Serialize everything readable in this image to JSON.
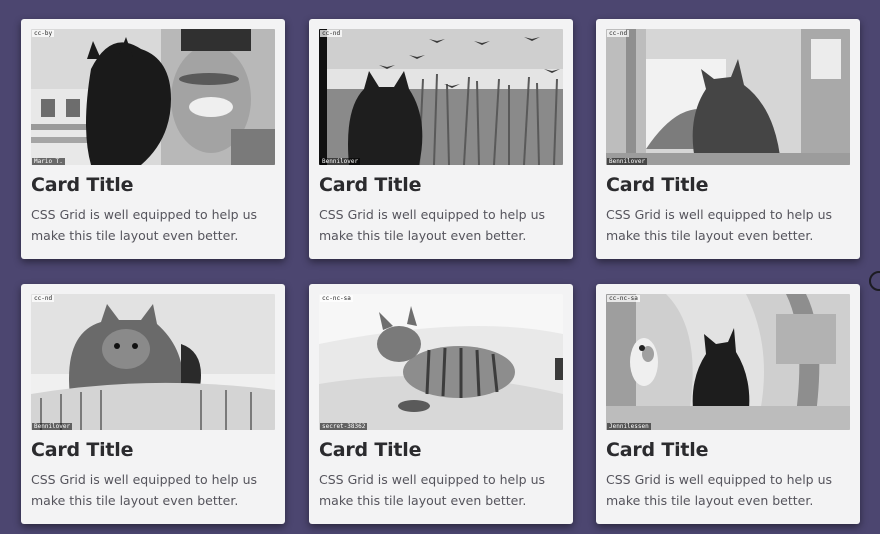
{
  "cards": [
    {
      "title": "Card Title",
      "description": "CSS Grid is well equipped to help us make this tile layout even better.",
      "image": {
        "alt": "man holding black cat",
        "license": "cc-by",
        "credit": "Mario T."
      }
    },
    {
      "title": "Card Title",
      "description": "CSS Grid is well equipped to help us make this tile layout even better.",
      "image": {
        "alt": "cat watching birds over wheat field",
        "license": "cc-nd",
        "credit": "Bennilover"
      }
    },
    {
      "title": "Card Title",
      "description": "CSS Grid is well equipped to help us make this tile layout even better.",
      "image": {
        "alt": "tabby cat at window",
        "license": "cc-nd",
        "credit": "Bennilover"
      }
    },
    {
      "title": "Card Title",
      "description": "CSS Grid is well equipped to help us make this tile layout even better.",
      "image": {
        "alt": "tabby cat in basket",
        "license": "cc-nd",
        "credit": "Bennilover"
      }
    },
    {
      "title": "Card Title",
      "description": "CSS Grid is well equipped to help us make this tile layout even better.",
      "image": {
        "alt": "tabby cat lying on bed",
        "license": "cc-nc-sa",
        "credit": "secret-38362"
      }
    },
    {
      "title": "Card Title",
      "description": "CSS Grid is well equipped to help us make this tile layout even better.",
      "image": {
        "alt": "black cat and dog by mural",
        "license": "cc-nc-sa",
        "credit": "Jennilessen"
      }
    }
  ],
  "colors": {
    "background": "#4c4670",
    "card": "#f3f3f4",
    "title": "#2b2b2e",
    "text": "#55545c"
  }
}
